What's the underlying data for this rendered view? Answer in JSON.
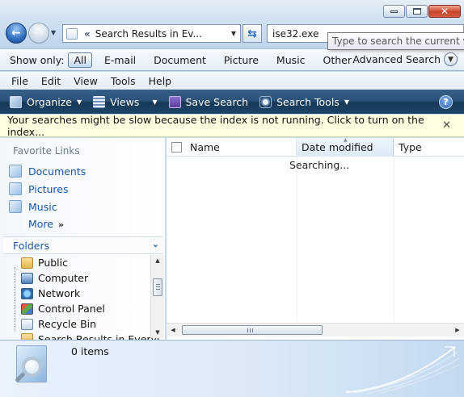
{
  "caption": {
    "minimize_icon": "minimize-icon",
    "maximize_icon": "maximize-icon",
    "close_icon": "close-icon",
    "close_glyph": "✕"
  },
  "nav": {
    "back_glyph": "←",
    "forward_glyph": "→",
    "history_glyph": "▼"
  },
  "address": {
    "chevron": "«",
    "path": "Search Results in Ev...",
    "drop_glyph": "▼",
    "refresh_glyph": "⇆"
  },
  "search": {
    "value": "ise32.exe",
    "tooltip": "Type to search the current view"
  },
  "show_only": {
    "label": "Show only:",
    "options": [
      "All",
      "E-mail",
      "Document",
      "Picture",
      "Music",
      "Other"
    ],
    "selected": "All",
    "advanced_search": "Advanced Search",
    "advanced_glyph": "▼"
  },
  "menu": [
    "File",
    "Edit",
    "View",
    "Tools",
    "Help"
  ],
  "commands": {
    "organize": "Organize",
    "views": "Views",
    "save_search": "Save Search",
    "search_tools": "Search Tools",
    "dropdown_glyph": "▼",
    "help_glyph": "?"
  },
  "infobar": {
    "message": "Your searches might be slow because the index is not running.  Click to turn on the index...",
    "close_glyph": "✕"
  },
  "favorites": {
    "header": "Favorite Links",
    "items": [
      "Documents",
      "Pictures",
      "Music"
    ],
    "more": "More",
    "more_glyph": "»"
  },
  "folders": {
    "header": "Folders",
    "chevron": "⌄",
    "items": [
      "Public",
      "Computer",
      "Network",
      "Control Panel",
      "Recycle Bin",
      "Search Results in Everyt"
    ]
  },
  "scroll": {
    "up": "▲",
    "down": "▼",
    "left": "◀",
    "right": "▶"
  },
  "filelist": {
    "columns": [
      "Name",
      "Date modified",
      "Type"
    ],
    "sort_glyph": "▲",
    "status": "Searching..."
  },
  "details": {
    "count": "0 items"
  },
  "colors": {
    "command_bar": "#1d4568",
    "infobar_bg": "#ffffe1",
    "link": "#1d55a6"
  }
}
